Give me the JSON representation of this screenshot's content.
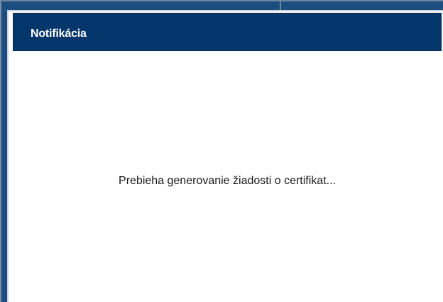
{
  "dialog": {
    "title": "Notifikácia",
    "message": "Prebieha generovanie žiadosti o certifikat..."
  },
  "colors": {
    "header_bg": "#03366a",
    "header_text": "#ffffff",
    "body_bg": "#ffffff",
    "message_text": "#1a1a1a",
    "backdrop": "#1d4e80"
  }
}
